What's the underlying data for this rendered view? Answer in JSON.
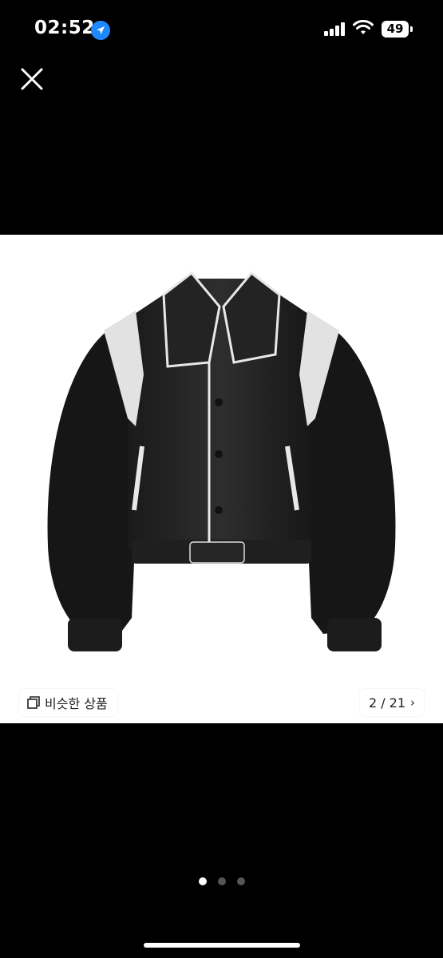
{
  "status_bar": {
    "time": "02:52",
    "battery": "49",
    "location_icon": "location-arrow-icon",
    "signal_icon": "cellular-signal-icon",
    "wifi_icon": "wifi-icon"
  },
  "toolbar": {
    "close_icon": "close-icon"
  },
  "product": {
    "image_description_icon": "jacket-photo",
    "similar_label": "비슷한 상품",
    "similar_icon": "copy-icon",
    "page_current": "2",
    "page_total": "21",
    "page_counter": "2 / 21"
  },
  "pager": {
    "dot_count": 3,
    "active_index": 0
  },
  "colors": {
    "background": "#000000",
    "accent": "#1e88ff",
    "image_bg": "#ffffff"
  }
}
